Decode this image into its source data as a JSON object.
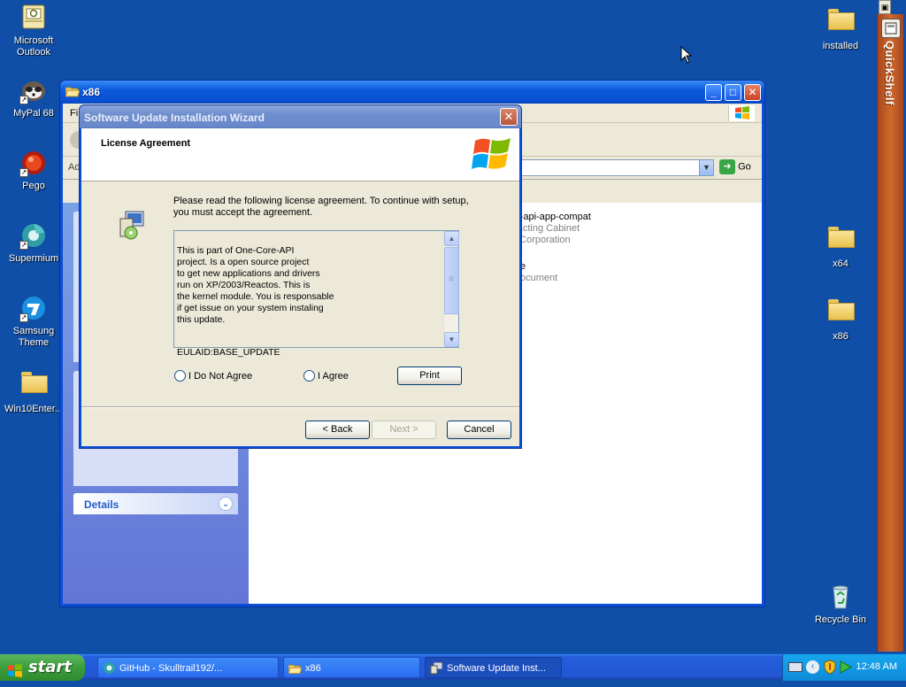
{
  "desktop": {
    "icons": [
      {
        "label": "Microsoft Outlook"
      },
      {
        "label": "MyPal 68"
      },
      {
        "label": "Pego"
      },
      {
        "label": "Supermium"
      },
      {
        "label": "Samsung Theme"
      },
      {
        "label": "Win10Enter..."
      },
      {
        "label": "installed"
      },
      {
        "label": "x64"
      },
      {
        "label": "x86"
      },
      {
        "label": "Recycle Bin"
      }
    ]
  },
  "explorer": {
    "title": "x86",
    "menu_partial": "Fi",
    "address_partial": "Ad",
    "go_label": "Go",
    "details_label": "Details",
    "files": [
      {
        "name": "re-api-app-compat",
        "sub1": "tracting Cabinet",
        "sub2": "ft Corporation"
      },
      {
        "name": "e",
        "sub1": "ocument"
      }
    ]
  },
  "wizard": {
    "title": "Software Update Installation Wizard",
    "header_title": "License Agreement",
    "instruction": "Please read the following license agreement. To continue with setup, you must accept the agreement.",
    "license_text": "This is part of One-Core-API\nproject. Is a open source project\nto get new applications and drivers\nrun on XP/2003/Reactos. This is\nthe kernel module. You is responsable\nif get issue on your system instaling\nthis update.",
    "eula_id": "EULAID:BASE_UPDATE",
    "radio_disagree": "I Do Not Agree",
    "radio_agree": "I Agree",
    "print_label": "Print",
    "back_label": "< Back",
    "next_label": "Next >",
    "cancel_label": "Cancel"
  },
  "quickshelf": {
    "label": "QuickShelf"
  },
  "taskbar": {
    "start_label": "start",
    "buttons": [
      {
        "label": "GitHub - Skulltrail192/...",
        "state": "idle"
      },
      {
        "label": "x86",
        "state": "idle"
      },
      {
        "label": "Software Update Inst...",
        "state": "active"
      }
    ],
    "clock": "12:48 AM"
  },
  "colors": {
    "desktop": "#0f4fa7",
    "taskbar": "#245edb",
    "start_button": "#3c9d3c",
    "tray": "#0e8ad9",
    "quickshelf": "#cf6a2c"
  }
}
